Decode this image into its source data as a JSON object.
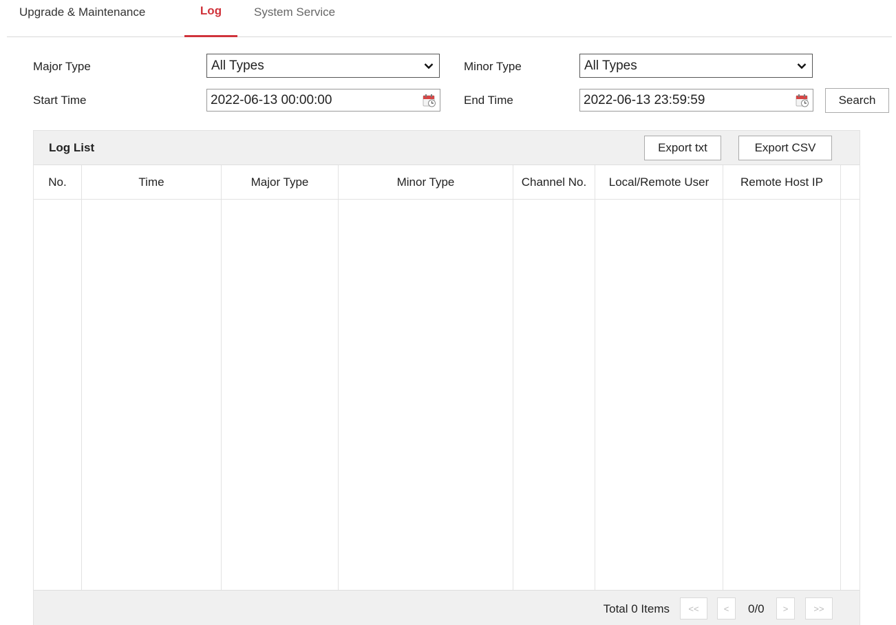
{
  "tabs": {
    "upgrade": "Upgrade & Maintenance",
    "log": "Log",
    "system_service": "System Service"
  },
  "filters": {
    "major_type_label": "Major Type",
    "major_type_value": "All Types",
    "minor_type_label": "Minor Type",
    "minor_type_value": "All Types",
    "start_time_label": "Start Time",
    "start_time_value": "2022-06-13 00:00:00",
    "end_time_label": "End Time",
    "end_time_value": "2022-06-13 23:59:59",
    "search_label": "Search"
  },
  "log_list": {
    "title": "Log List",
    "export_txt": "Export txt",
    "export_csv": "Export CSV",
    "columns": [
      "No.",
      "Time",
      "Major Type",
      "Minor Type",
      "Channel No.",
      "Local/Remote User",
      "Remote Host IP"
    ],
    "rows": []
  },
  "pagination": {
    "total": "Total 0 Items",
    "first": "<<",
    "prev": "<",
    "page": "0/0",
    "next": ">",
    "last": ">>"
  },
  "colors": {
    "accent": "#d0333b",
    "panel_bg": "#f0f0f0",
    "border": "#e2e2e2"
  },
  "icons": {
    "select_arrow": "chevron-down-icon",
    "date_picker": "calendar-icon"
  }
}
